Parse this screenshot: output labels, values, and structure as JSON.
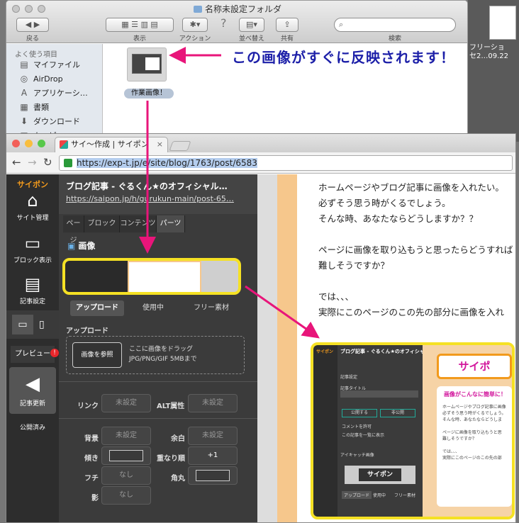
{
  "finder": {
    "title": "名称未設定フォルダ",
    "back_label": "戻る",
    "view_label": "表示",
    "action_label": "アクション",
    "sort_label": "並べ替え",
    "share_label": "共有",
    "search_label": "検索",
    "sidebar_heading": "よく使う項目",
    "sidebar_items": [
      "マイファイル",
      "AirDrop",
      "アプリケーシ…",
      "書類",
      "ダウンロード",
      "ムービー"
    ],
    "file_name": "作業画像！"
  },
  "desktop": {
    "file_label": "フリーショ\nセ2…09.22"
  },
  "callout": "この画像がすぐに反映されます！",
  "browser": {
    "tab_title": "サイ～作成 | サイポン",
    "url_prefix": "https://exp-t.jp",
    "url_rest": "/e/site/blog/1763/post/6583"
  },
  "rail": {
    "logo": "サイポン",
    "items": [
      "サイト管理",
      "ブロック表示",
      "記事設定",
      "プレビュー",
      "記事更新",
      "公開済み"
    ]
  },
  "panel": {
    "title": "ブログ記事 - ぐるくん★のオフィシャル…",
    "url": "https://saipon.jp/h/gurukun-main/post-65…",
    "tabs": [
      "ページ",
      "ブロック",
      "コンテンツ",
      "パーツ"
    ],
    "image_heading": "画像",
    "image_tabs": [
      "アップロード",
      "使用中",
      "フリー素材"
    ],
    "upload_heading": "アップロード",
    "browse_button": "画像を参照",
    "drop_text_1": "ここに画像をドラッグ",
    "drop_text_2": "JPG/PNG/GIF 5MBまで",
    "link_label": "リンク",
    "link_value": "未設定",
    "alt_label": "ALT属性",
    "alt_value": "未設定",
    "bg_label": "背景",
    "bg_value": "未設定",
    "margin_label": "余白",
    "margin_value": "未設定",
    "tilt_label": "傾き",
    "overlap_label": "重なり順",
    "overlap_value": "+1",
    "border_label": "フチ",
    "border_value": "なし",
    "radius_label": "角丸",
    "shadow_label": "影",
    "shadow_value": "なし"
  },
  "preview": {
    "lines": [
      "ホームページやブログ記事に画像を入れたい。",
      "必ずそう思う時がくるでしょう。",
      "そんな時、あなたならどうしますか？？",
      "",
      "ページに画像を取り込もうと思ったらどうすれば",
      "難しそうですか？",
      "",
      "では、、、",
      "実際にこのページのこの先の部分に画像を入れ"
    ]
  },
  "inset": {
    "logo": "サイポン",
    "title": "ブログ記事 - ぐるくん★のオフィシャル…",
    "section1": "記事設定",
    "field": "記事タイトル",
    "public_btn": "公開する",
    "private_btn": "非公開",
    "comment_check": "コメントを許可",
    "list_check": "この記事を一覧に表示",
    "eyecatch": "アイキャッチ画像",
    "saipon_btn": "サイポン",
    "tabs": [
      "アップロード",
      "使用中",
      "フリー素材"
    ],
    "card_title": "サイポ",
    "body_title": "画像がこんなに簡単に！",
    "body_lines": [
      "ホームページやブログ記事に画像",
      "必ずそう思う時がくるでしょう。",
      "そんな時、あなたならどうしま",
      "",
      "ページに画像を取り込もうと思",
      "難しそうですか？",
      "",
      "では、、、",
      "実際にこのページのこの先の部"
    ]
  }
}
